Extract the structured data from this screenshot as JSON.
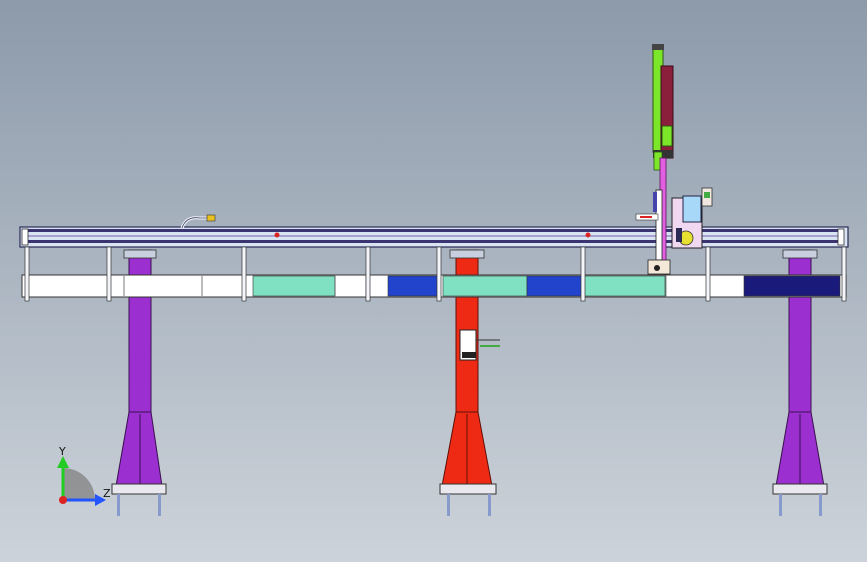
{
  "colors": {
    "bg_top": "#8c9aaa",
    "bg_bottom": "#cdd3da",
    "beam": "#d9e4f2",
    "beam_rail": "#3a3470",
    "leg_purple": "#9b2fd0",
    "leg_red": "#ee2a14",
    "column_green": "#7ce62a",
    "column_maroon": "#8a1f3c",
    "carriage_pink": "#e060e0",
    "panel_white": "#ffffff",
    "panel_teal": "#7fe0c2",
    "panel_blue": "#2244cc",
    "panel_navy": "#1a1a7a",
    "axis_x": "#2255ff",
    "axis_y": "#22cc22",
    "axis_origin": "#dd2222"
  },
  "triad": {
    "y_label": "Y",
    "z_label": "Z"
  },
  "icons": {
    "axis_triad": "axis-triad-icon"
  }
}
